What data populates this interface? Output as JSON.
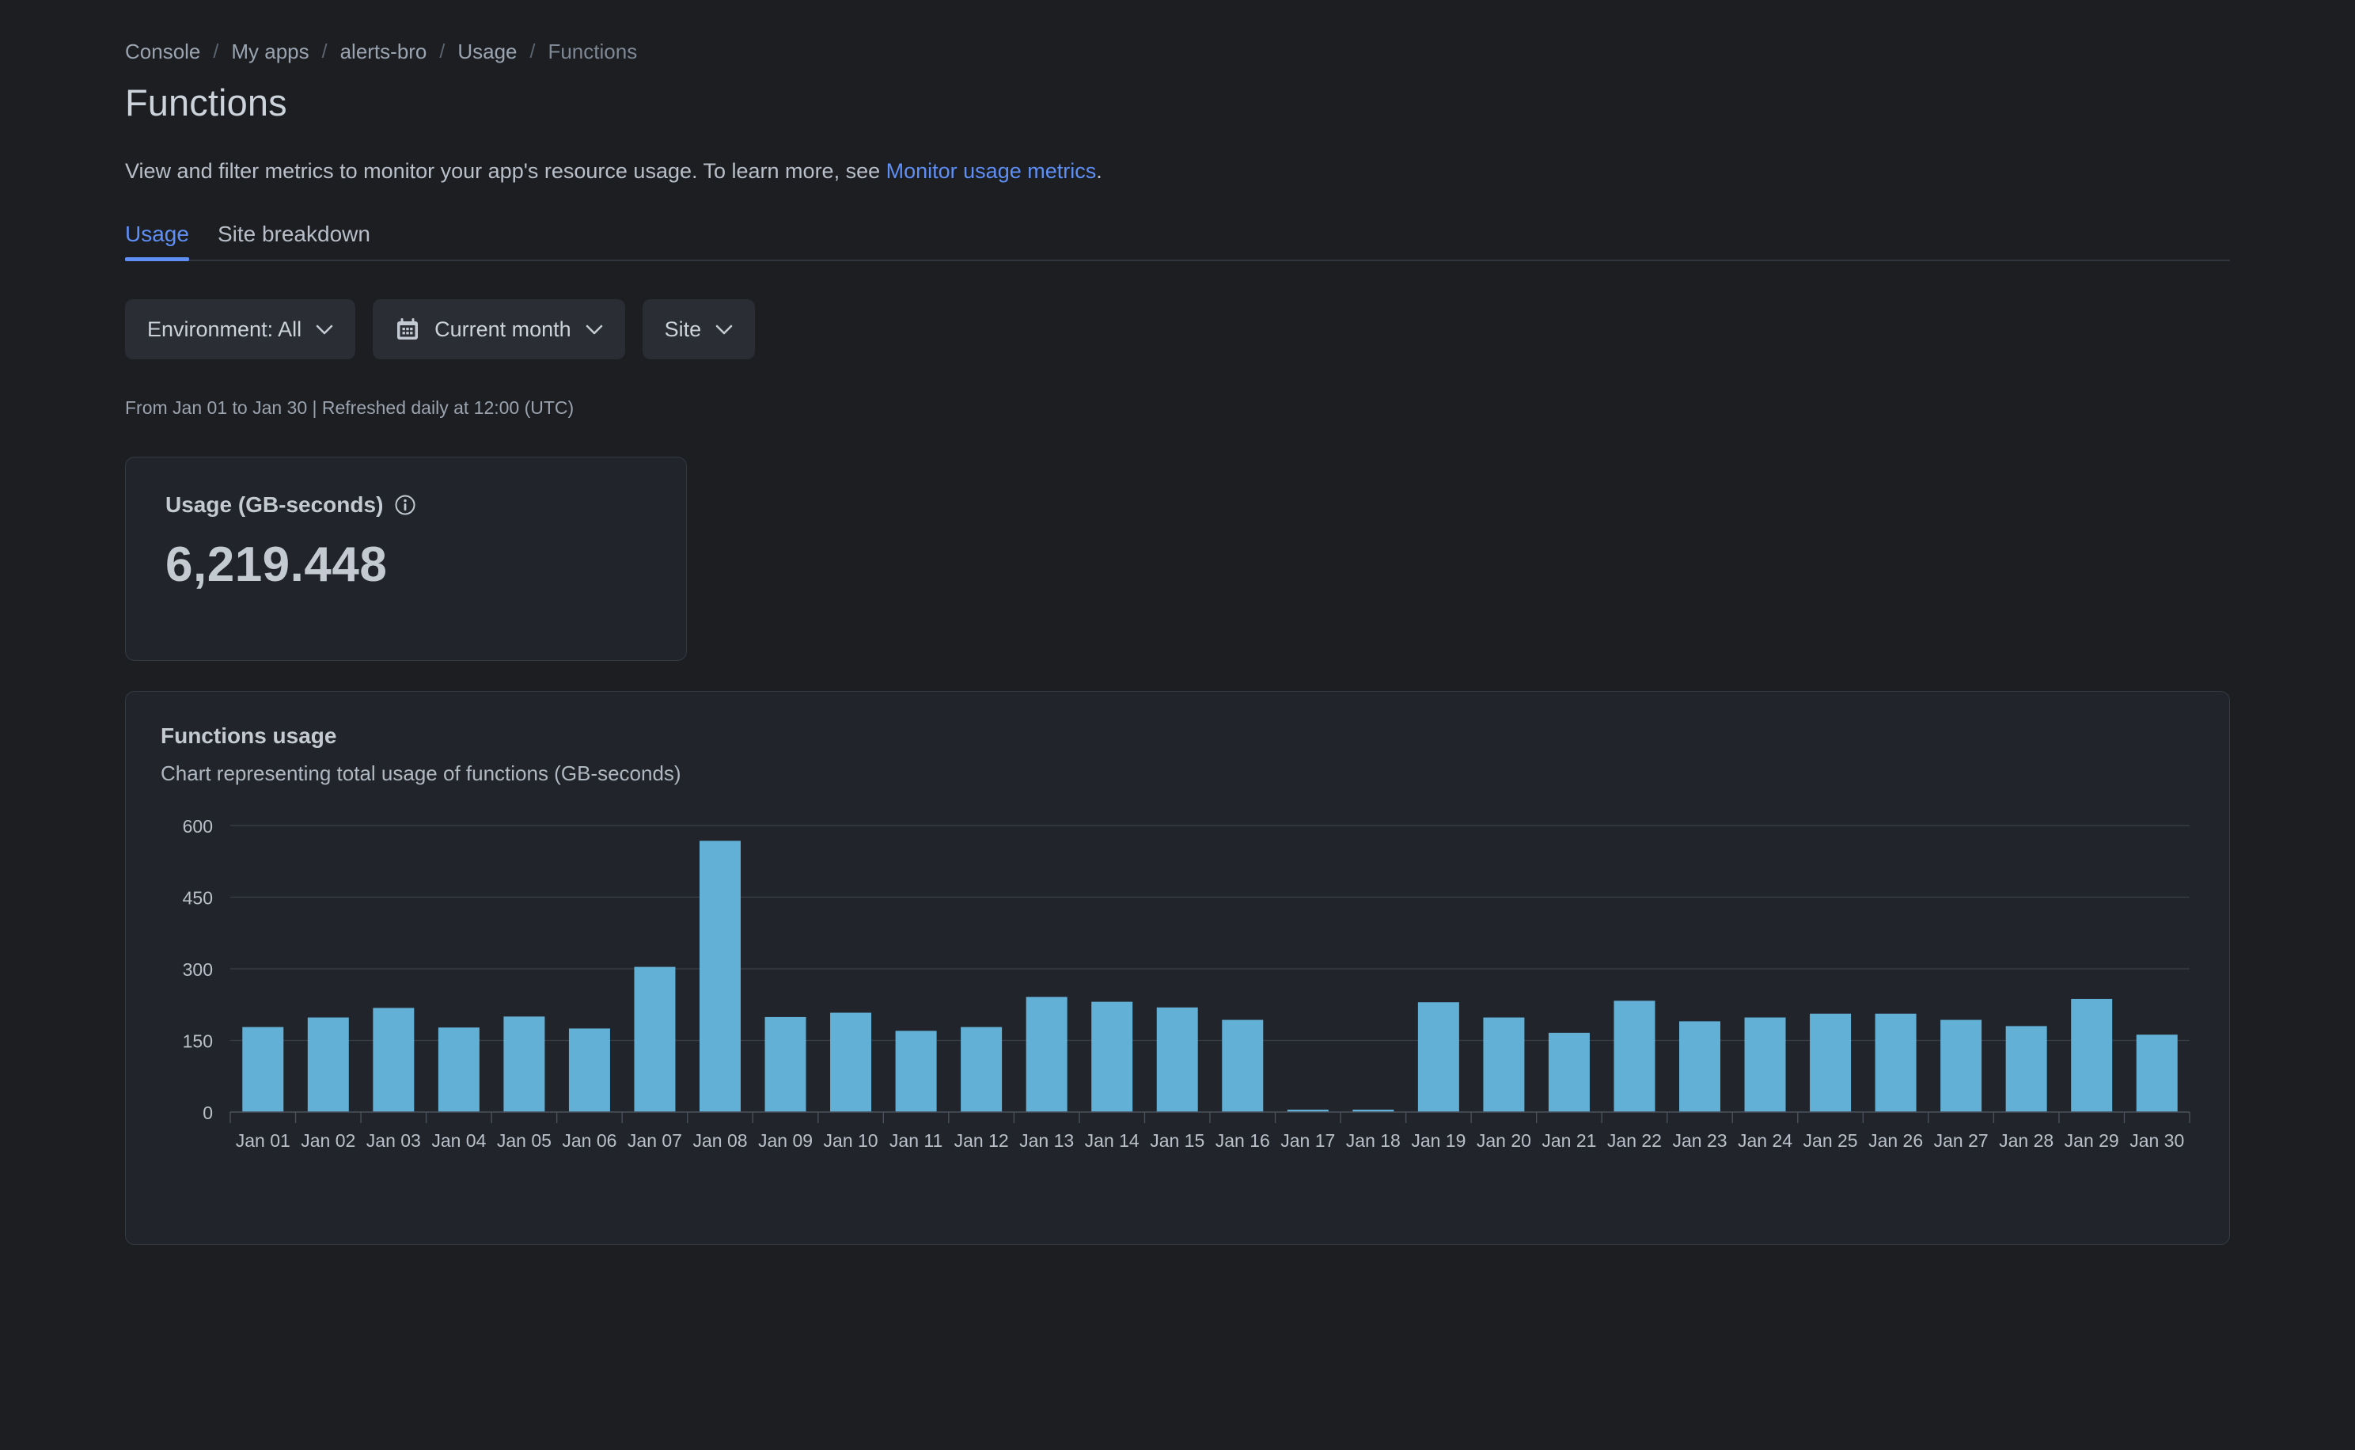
{
  "breadcrumb": {
    "separator": "/",
    "items": [
      {
        "label": "Console",
        "current": false
      },
      {
        "label": "My apps",
        "current": false
      },
      {
        "label": "alerts-bro",
        "current": false
      },
      {
        "label": "Usage",
        "current": false
      },
      {
        "label": "Functions",
        "current": true
      }
    ]
  },
  "header": {
    "title": "Functions",
    "description_before": "View and filter metrics to monitor your app's resource usage. To learn more, see ",
    "description_link": "Monitor usage metrics",
    "description_after": "."
  },
  "tabs": [
    {
      "label": "Usage",
      "active": true
    },
    {
      "label": "Site breakdown",
      "active": false
    }
  ],
  "filters": {
    "environment": {
      "label": "Environment: All",
      "icon": "chevron-down-icon"
    },
    "period": {
      "label": "Current month",
      "icon": "calendar-icon"
    },
    "site": {
      "label": "Site",
      "icon": "chevron-down-icon"
    }
  },
  "refresh_note": "From Jan 01 to Jan 30 | Refreshed daily at 12:00 (UTC)",
  "stat_card": {
    "label": "Usage (GB-seconds)",
    "info_icon": "info-icon",
    "value": "6,219.448"
  },
  "chart_card": {
    "title": "Functions usage",
    "subtitle": "Chart representing total usage of functions (GB-seconds)"
  },
  "colors": {
    "page_background": "#1c1e22",
    "card_background": "#21242a",
    "card_border": "#343a42",
    "bar_fill": "#62b0d6",
    "accent_blue": "#5f8ff5",
    "grid_line": "#3a4048",
    "text_primary": "#c6ccd4",
    "text_muted": "#9aa3ae",
    "control_background": "#2a2d34"
  },
  "chart_data": {
    "type": "bar",
    "title": "Functions usage",
    "subtitle": "Chart representing total usage of functions (GB-seconds)",
    "xlabel": "",
    "ylabel": "",
    "ylim": [
      0,
      600
    ],
    "yticks": [
      0,
      150,
      300,
      450,
      600
    ],
    "ytick_labels": [
      "0",
      "150",
      "300",
      "450",
      "600"
    ],
    "grid": true,
    "legend": false,
    "categories": [
      "Jan 01",
      "Jan 02",
      "Jan 03",
      "Jan 04",
      "Jan 05",
      "Jan 06",
      "Jan 07",
      "Jan 08",
      "Jan 09",
      "Jan 10",
      "Jan 11",
      "Jan 12",
      "Jan 13",
      "Jan 14",
      "Jan 15",
      "Jan 16",
      "Jan 17",
      "Jan 18",
      "Jan 19",
      "Jan 20",
      "Jan 21",
      "Jan 22",
      "Jan 23",
      "Jan 24",
      "Jan 25",
      "Jan 26",
      "Jan 27",
      "Jan 28",
      "Jan 29",
      "Jan 30"
    ],
    "values": [
      178,
      198,
      218,
      177,
      200,
      175,
      304,
      568,
      199,
      208,
      170,
      178,
      241,
      231,
      219,
      193,
      5,
      5,
      230,
      198,
      166,
      233,
      190,
      198,
      206,
      206,
      193,
      180,
      237,
      162
    ]
  }
}
